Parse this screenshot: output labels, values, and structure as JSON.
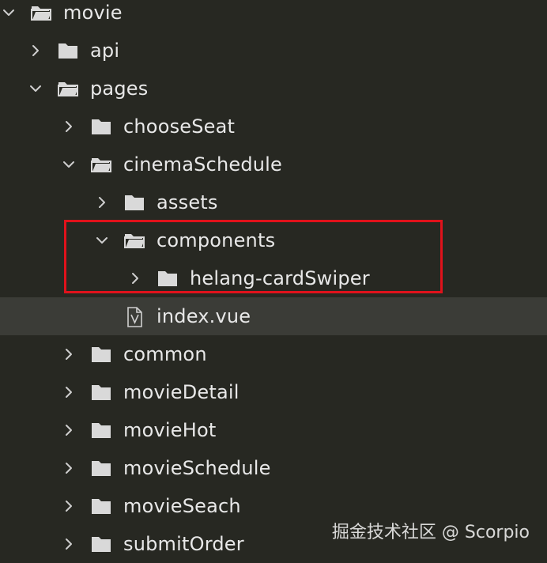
{
  "tree": [
    {
      "label": "movie",
      "depth": 0,
      "type": "folder",
      "expanded": true
    },
    {
      "label": "api",
      "depth": 1,
      "type": "folder",
      "expanded": false
    },
    {
      "label": "pages",
      "depth": 1,
      "type": "folder",
      "expanded": true
    },
    {
      "label": "chooseSeat",
      "depth": 2,
      "type": "folder",
      "expanded": false
    },
    {
      "label": "cinemaSchedule",
      "depth": 2,
      "type": "folder",
      "expanded": true
    },
    {
      "label": "assets",
      "depth": 3,
      "type": "folder",
      "expanded": false
    },
    {
      "label": "components",
      "depth": 3,
      "type": "folder",
      "expanded": true
    },
    {
      "label": "helang-cardSwiper",
      "depth": 4,
      "type": "folder",
      "expanded": false
    },
    {
      "label": "index.vue",
      "depth": 3,
      "type": "file",
      "selected": true
    },
    {
      "label": "common",
      "depth": 2,
      "type": "folder",
      "expanded": false
    },
    {
      "label": "movieDetail",
      "depth": 2,
      "type": "folder",
      "expanded": false
    },
    {
      "label": "movieHot",
      "depth": 2,
      "type": "folder",
      "expanded": false
    },
    {
      "label": "movieSchedule",
      "depth": 2,
      "type": "folder",
      "expanded": false
    },
    {
      "label": "movieSeach",
      "depth": 2,
      "type": "folder",
      "expanded": false
    },
    {
      "label": "submitOrder",
      "depth": 2,
      "type": "folder",
      "expanded": false
    }
  ],
  "watermark": "掘金技术社区 @ Scorpio",
  "colors": {
    "background": "#272822",
    "selected_row": "#3b3c37",
    "highlight_border": "#e0121b",
    "text": "#e8e8e8",
    "icon": "#d6d6d6"
  },
  "icons": {
    "collapsed": "chevron-right-icon",
    "expanded": "chevron-down-icon",
    "folder_closed": "folder-icon",
    "folder_open": "folder-open-icon",
    "file": "vue-file-icon"
  }
}
